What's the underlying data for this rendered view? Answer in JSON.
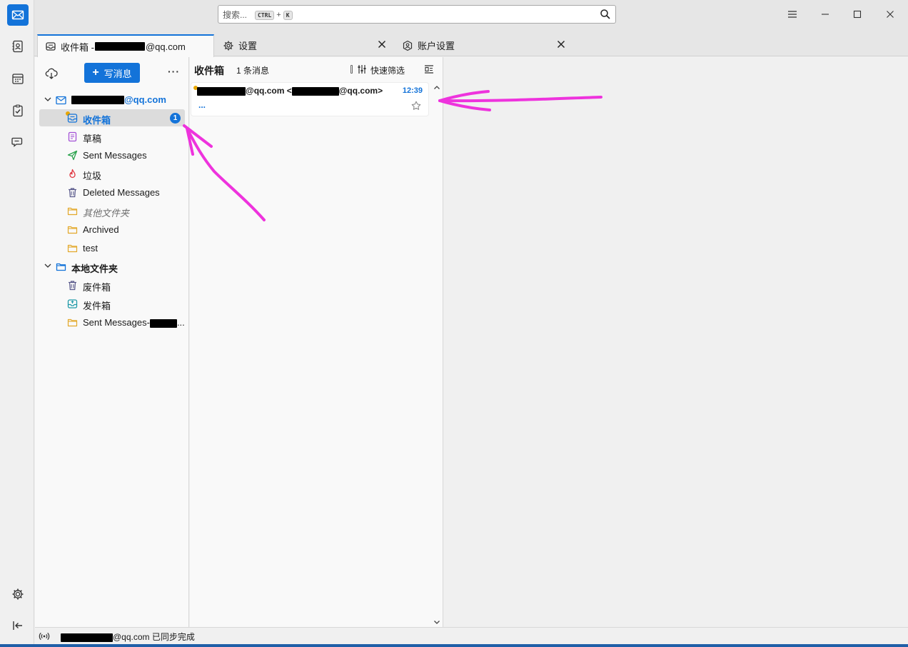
{
  "app": {
    "accent": "#1373d9"
  },
  "spaces": [
    {
      "name": "mail-icon"
    },
    {
      "name": "address-book-icon"
    },
    {
      "name": "calendar-icon"
    },
    {
      "name": "tasks-icon"
    },
    {
      "name": "chat-icon"
    },
    {
      "name": "settings-icon"
    },
    {
      "name": "collapse-icon"
    }
  ],
  "search": {
    "placeholder": "搜索...",
    "key1": "CTRL",
    "plus": "+",
    "key2": "K"
  },
  "tabs": [
    {
      "label_prefix": "收件箱 - ",
      "label_suffix": "@qq.com",
      "active": true
    },
    {
      "label": "设置"
    },
    {
      "label": "账户设置"
    }
  ],
  "folder_pane": {
    "compose_label": "写消息",
    "more": "···",
    "account_suffix": "@qq.com",
    "folders": [
      {
        "label": "收件箱",
        "unread": "1"
      },
      {
        "label": "草稿"
      },
      {
        "label": "Sent Messages"
      },
      {
        "label": "垃圾"
      },
      {
        "label": "Deleted Messages"
      },
      {
        "label": "其他文件夹"
      },
      {
        "label": "Archived"
      },
      {
        "label": "test"
      }
    ],
    "local_account": "本地文件夹",
    "local_folders": [
      {
        "label": "废件箱"
      },
      {
        "label": "发件箱"
      },
      {
        "label_prefix": "Sent Messages-",
        "label_suffix": "..."
      }
    ]
  },
  "thread_pane": {
    "title": "收件箱",
    "count": "1 条消息",
    "quick_filter": "快速筛选",
    "message": {
      "sender_mid": "@qq.com <",
      "sender_end": "@qq.com>",
      "time": "12:39",
      "preview": "..."
    }
  },
  "status": {
    "suffix": "@qq.com 已同步完成"
  }
}
